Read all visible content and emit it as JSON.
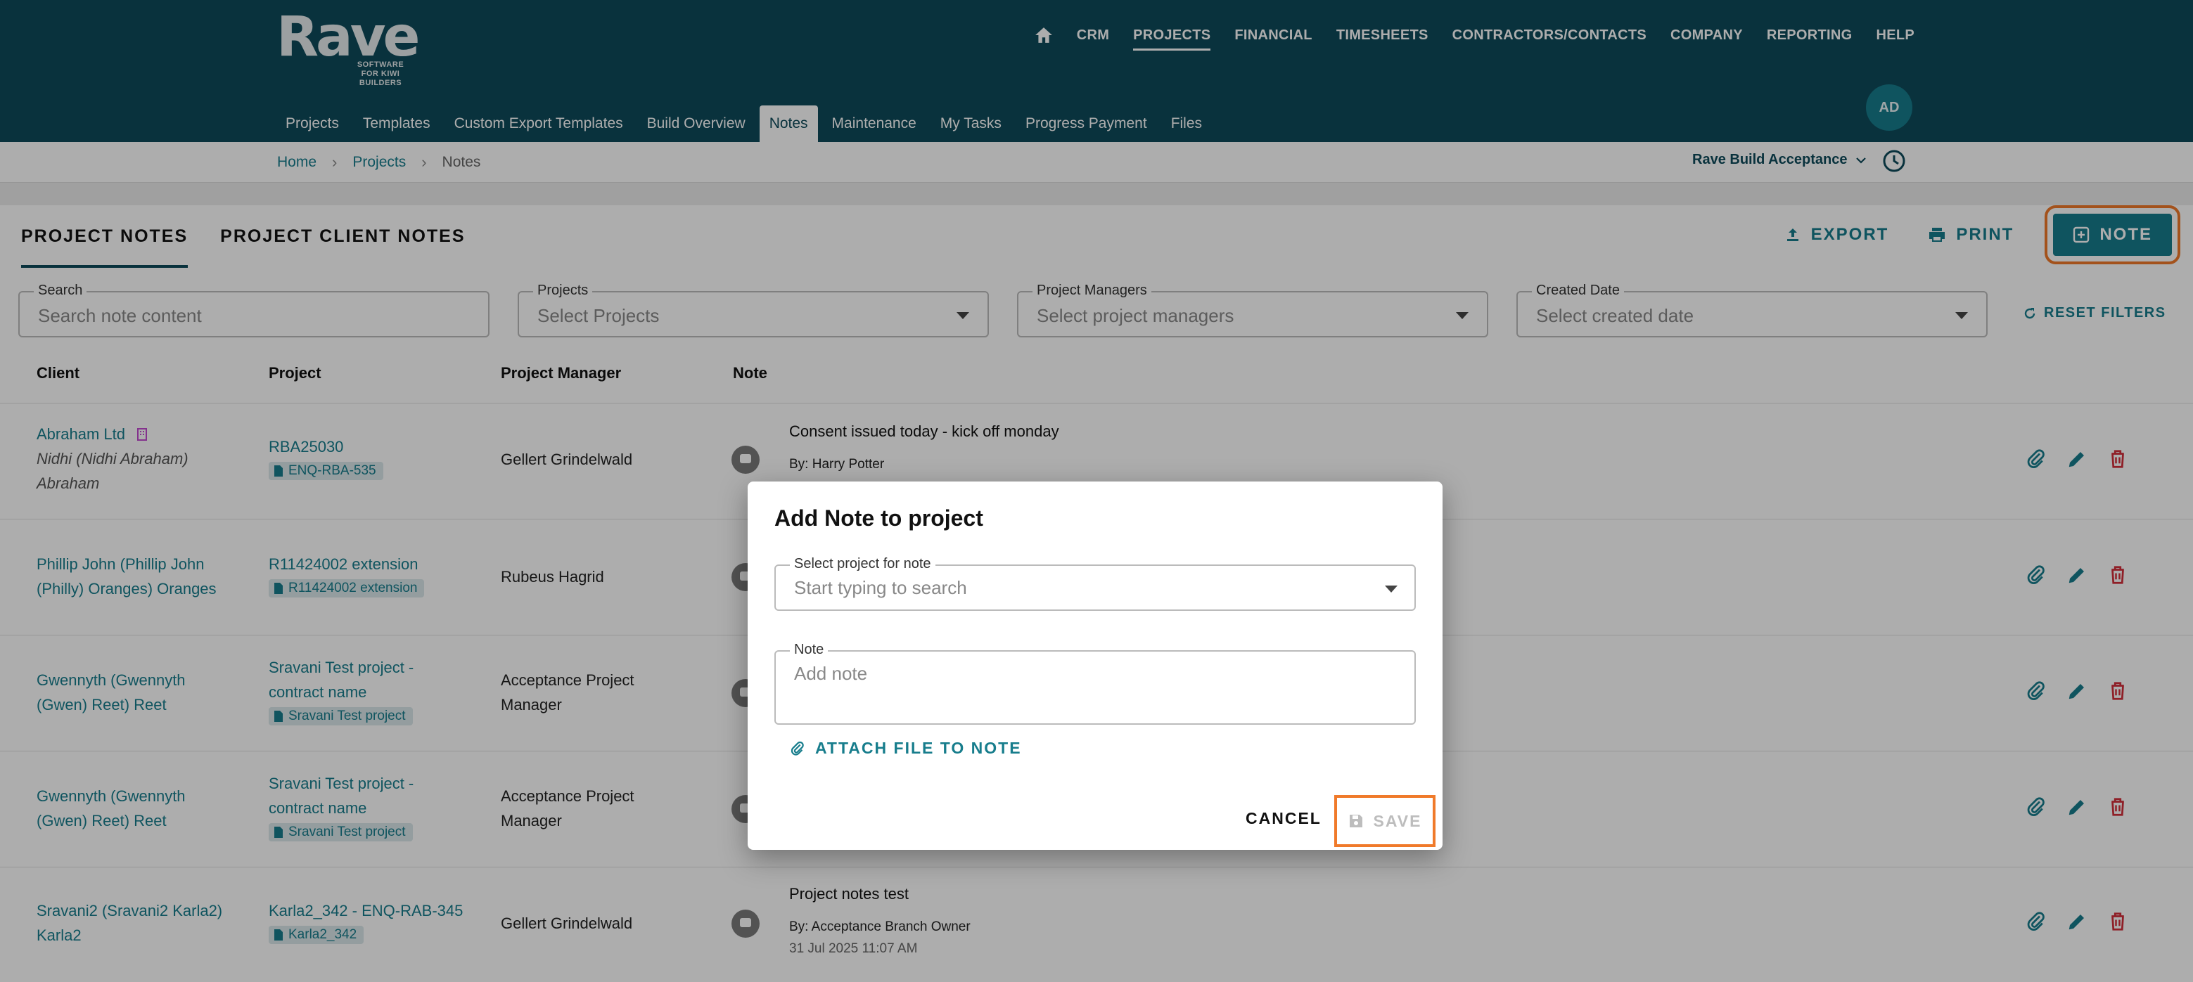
{
  "logo": {
    "word": "Rave",
    "tagline": "SOFTWARE FOR KIWI BUILDERS"
  },
  "topnav": [
    {
      "label": "CRM"
    },
    {
      "label": "PROJECTS"
    },
    {
      "label": "FINANCIAL"
    },
    {
      "label": "TIMESHEETS"
    },
    {
      "label": "CONTRACTORS/CONTACTS"
    },
    {
      "label": "COMPANY"
    },
    {
      "label": "REPORTING"
    },
    {
      "label": "HELP"
    }
  ],
  "subnav": [
    {
      "label": "Projects"
    },
    {
      "label": "Templates"
    },
    {
      "label": "Custom Export Templates"
    },
    {
      "label": "Build Overview"
    },
    {
      "label": "Notes"
    },
    {
      "label": "Maintenance"
    },
    {
      "label": "My Tasks"
    },
    {
      "label": "Progress Payment"
    },
    {
      "label": "Files"
    }
  ],
  "user": {
    "initials": "AD"
  },
  "breadcrumb": {
    "home": "Home",
    "projects": "Projects",
    "current": "Notes"
  },
  "account": {
    "name": "Rave Build Acceptance"
  },
  "page_tabs": {
    "project_notes": "PROJECT NOTES",
    "client_notes": "PROJECT CLIENT NOTES"
  },
  "actions": {
    "export": "EXPORT",
    "print": "PRINT",
    "note": "NOTE"
  },
  "filters": {
    "search": {
      "label": "Search",
      "placeholder": "Search note content"
    },
    "projects": {
      "label": "Projects",
      "placeholder": "Select Projects"
    },
    "managers": {
      "label": "Project Managers",
      "placeholder": "Select project managers"
    },
    "date": {
      "label": "Created Date",
      "placeholder": "Select created date"
    },
    "reset": "RESET FILTERS"
  },
  "columns": {
    "client": "Client",
    "project": "Project",
    "manager": "Project Manager",
    "note": "Note"
  },
  "rows": [
    {
      "client": "Abraham Ltd",
      "alias1": "Nidhi (Nidhi Abraham)",
      "alias2": "Abraham",
      "project": "RBA25030",
      "chip": "ENQ-RBA-535",
      "manager": "Gellert Grindelwald",
      "note": "Consent issued today - kick off monday",
      "by": "By: Harry Potter"
    },
    {
      "client1": "Phillip John (Phillip John",
      "client2": "(Philly) Oranges) Oranges",
      "project": "R11424002 extension",
      "chip": "R11424002 extension",
      "manager": "Rubeus Hagrid"
    },
    {
      "client1": "Gwennyth (Gwennyth",
      "client2": "(Gwen) Reet) Reet",
      "project1": "Sravani Test project -",
      "project2": "contract name",
      "chip": "Sravani Test project",
      "manager1": "Acceptance Project",
      "manager2": "Manager"
    },
    {
      "client1": "Gwennyth (Gwennyth",
      "client2": "(Gwen) Reet) Reet",
      "project1": "Sravani Test project -",
      "project2": "contract name",
      "chip": "Sravani Test project",
      "manager1": "Acceptance Project",
      "manager2": "Manager"
    },
    {
      "client1": "Sravani2 (Sravani2 Karla2)",
      "client2": "Karla2",
      "project": "Karla2_342 - ENQ-RAB-345",
      "chip": "Karla2_342",
      "manager": "Gellert Grindelwald",
      "note": "Project notes test",
      "by": "By: Acceptance Branch Owner",
      "timestamp": "31 Jul 2025 11:07 AM"
    }
  ],
  "dialog": {
    "title": "Add Note to project",
    "project_label": "Select project for note",
    "project_placeholder": "Start typing to search",
    "note_label": "Note",
    "note_placeholder": "Add note",
    "attach": "ATTACH FILE TO NOTE",
    "cancel": "CANCEL",
    "save": "SAVE"
  },
  "colors": {
    "header": "#0e4a5a",
    "accent": "#177d8c",
    "danger": "#d32f3a",
    "highlight": "#f07a2a"
  }
}
